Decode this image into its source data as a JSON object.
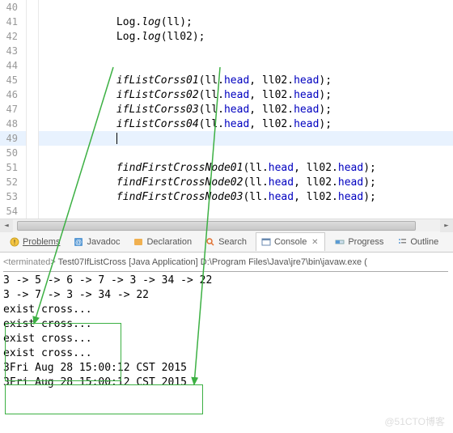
{
  "editor": {
    "lines": [
      {
        "num": "40"
      },
      {
        "num": "41",
        "indent": "            ",
        "call": "Log.",
        "method": "log",
        "args": "(ll);"
      },
      {
        "num": "42",
        "indent": "            ",
        "call": "Log.",
        "method": "log",
        "args": "(ll02);"
      },
      {
        "num": "43"
      },
      {
        "num": "44"
      },
      {
        "num": "45",
        "indent": "            ",
        "method": "ifListCorss01",
        "args_pre": "(ll.",
        "m1": "head",
        "args_mid": ", ll02.",
        "m2": "head",
        "args_post": ");"
      },
      {
        "num": "46",
        "indent": "            ",
        "method": "ifListCorss02",
        "args_pre": "(ll.",
        "m1": "head",
        "args_mid": ", ll02.",
        "m2": "head",
        "args_post": ");"
      },
      {
        "num": "47",
        "indent": "            ",
        "method": "ifListCorss03",
        "args_pre": "(ll.",
        "m1": "head",
        "args_mid": ", ll02.",
        "m2": "head",
        "args_post": ");"
      },
      {
        "num": "48",
        "indent": "            ",
        "method": "ifListCorss04",
        "args_pre": "(ll.",
        "m1": "head",
        "args_mid": ", ll02.",
        "m2": "head",
        "args_post": ");"
      },
      {
        "num": "49",
        "cursor": true,
        "indent": "            "
      },
      {
        "num": "50"
      },
      {
        "num": "51",
        "indent": "            ",
        "method": "findFirstCrossNode01",
        "args_pre": "(ll.",
        "m1": "head",
        "args_mid": ", ll02.",
        "m2": "head",
        "args_post": ");"
      },
      {
        "num": "52",
        "indent": "            ",
        "method": "findFirstCrossNode02",
        "args_pre": "(ll.",
        "m1": "head",
        "args_mid": ", ll02.",
        "m2": "head",
        "args_post": ");"
      },
      {
        "num": "53",
        "indent": "            ",
        "method": "findFirstCrossNode03",
        "args_pre": "(ll.",
        "m1": "head",
        "args_mid": ", ll02.",
        "m2": "head",
        "args_post": ");"
      },
      {
        "num": "54"
      }
    ]
  },
  "tabs": {
    "problems": "Problems",
    "javadoc": "Javadoc",
    "declaration": "Declaration",
    "search": "Search",
    "console": "Console",
    "progress": "Progress",
    "outline": "Outline"
  },
  "console": {
    "header_prefix": "<terminated>",
    "header_rest": " Test07IfListCross [Java Application] D:\\Program Files\\Java\\jre7\\bin\\javaw.exe (",
    "lines": [
      "3 -> 5 -> 6 -> 7 -> 3 -> 34 -> 22",
      "3 -> 7 -> 3 -> 34 -> 22",
      "exist cross...",
      "exist cross...",
      "exist cross...",
      "exist cross...",
      "3Fri Aug 28 15:00:12 CST 2015",
      "3Fri Aug 28 15:00:12 CST 2015"
    ]
  },
  "watermark": "@51CTO博客"
}
